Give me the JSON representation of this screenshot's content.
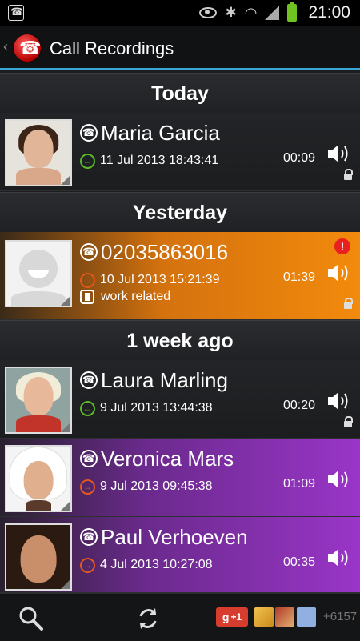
{
  "status_bar": {
    "time": "21:00"
  },
  "app_bar": {
    "title": "Call Recordings"
  },
  "sections": [
    {
      "label": "Today"
    },
    {
      "label": "Yesterday"
    },
    {
      "label": "1 week ago"
    }
  ],
  "recordings": [
    {
      "name": "Maria Garcia",
      "datetime": "11 Jul 2013 18:43:41",
      "duration": "00:09",
      "direction": "incoming"
    },
    {
      "name": "02035863016",
      "datetime": "10 Jul 2013 15:21:39",
      "duration": "01:39",
      "direction": "outgoing",
      "note": "work related",
      "color": "#f28a0c"
    },
    {
      "name": "Laura Marling",
      "datetime": "9 Jul 2013 13:44:38",
      "duration": "00:20",
      "direction": "incoming"
    },
    {
      "name": "Veronica Mars",
      "datetime": "9 Jul 2013 09:45:38",
      "duration": "01:09",
      "direction": "outgoing",
      "color": "#9a35c8"
    },
    {
      "name": "Paul Verhoeven",
      "datetime": "4 Jul 2013 10:27:08",
      "duration": "00:35",
      "direction": "outgoing",
      "color": "#9a35c8"
    }
  ],
  "bottom_bar": {
    "gplus_label": "+1",
    "plus_count": "+6157"
  },
  "colors": {
    "accent": "#3aa6d6",
    "incoming": "#5ab82a",
    "outgoing": "#e3571d"
  }
}
